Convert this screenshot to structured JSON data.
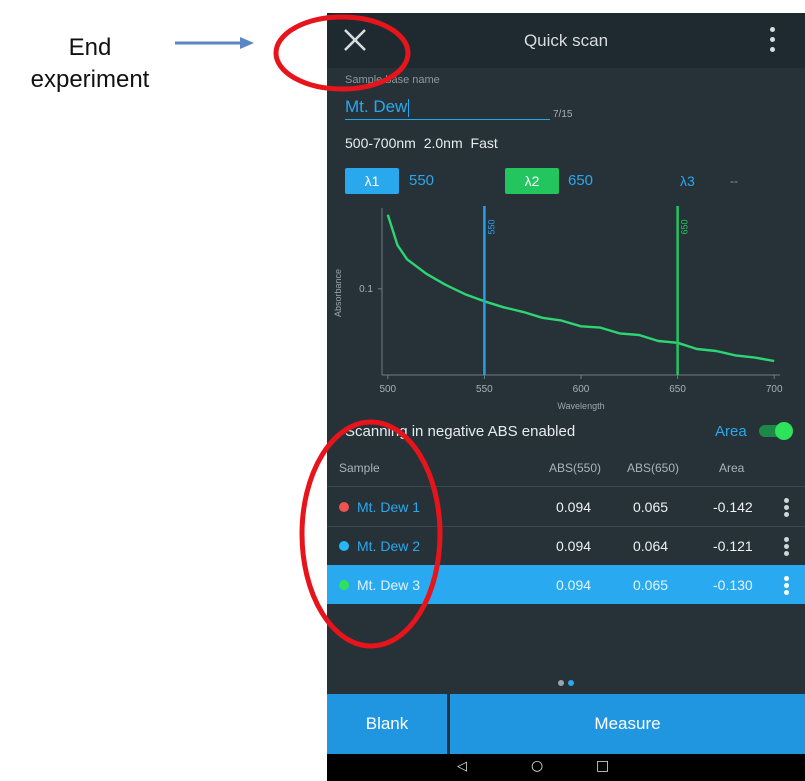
{
  "annotation": {
    "line1": "End",
    "line2": "experiment"
  },
  "header": {
    "title": "Quick scan"
  },
  "sample": {
    "label": "Sample base name",
    "value": "Mt. Dew",
    "counter": "7/15"
  },
  "params": {
    "range": "500-700nm",
    "resolution": "2.0nm",
    "speed": "Fast"
  },
  "lambdas": [
    {
      "label": "λ1",
      "value": "550",
      "color": "#2aa8ee"
    },
    {
      "label": "λ2",
      "value": "650",
      "color": "#22c55e"
    },
    {
      "label": "λ3",
      "value": "--",
      "color": "#2aa8ee"
    }
  ],
  "chart_data": {
    "type": "line",
    "xlabel": "Wavelength",
    "ylabel": "Absorbance",
    "x_ticks": [
      "500",
      "550",
      "600",
      "650",
      "700"
    ],
    "y_ticks": [
      "0.1"
    ],
    "xlim": [
      497,
      703
    ],
    "log_y": true,
    "ylim": [
      0.055,
      0.18
    ],
    "markers": [
      {
        "label": "550",
        "x": 550,
        "color": "#2a9fe8"
      },
      {
        "label": "650",
        "x": 650,
        "color": "#22c55e"
      }
    ],
    "series": [
      {
        "color": "#2ed573",
        "x": [
          500,
          505,
          510,
          520,
          530,
          540,
          550,
          560,
          570,
          580,
          590,
          600,
          610,
          620,
          630,
          640,
          650,
          660,
          670,
          680,
          690,
          700
        ],
        "y": [
          0.175,
          0.139,
          0.125,
          0.112,
          0.103,
          0.096,
          0.091,
          0.087,
          0.084,
          0.081,
          0.078,
          0.076,
          0.074,
          0.072,
          0.07,
          0.068,
          0.066,
          0.064,
          0.062,
          0.061,
          0.059,
          0.058
        ]
      }
    ]
  },
  "options": {
    "negative_abs": "Scanning in negative ABS enabled",
    "area_label": "Area",
    "area_enabled": true
  },
  "table": {
    "headers": [
      "Sample",
      "ABS(550)",
      "ABS(650)",
      "Area"
    ],
    "rows": [
      {
        "name": "Mt. Dew 1",
        "color": "#ef5350",
        "abs550": "0.094",
        "abs650": "0.065",
        "area": "-0.142",
        "selected": false
      },
      {
        "name": "Mt. Dew 2",
        "color": "#29b6f6",
        "abs550": "0.094",
        "abs650": "0.064",
        "area": "-0.121",
        "selected": false
      },
      {
        "name": "Mt. Dew 3",
        "color": "#2ee25c",
        "abs550": "0.094",
        "abs650": "0.065",
        "area": "-0.130",
        "selected": true
      }
    ]
  },
  "buttons": {
    "blank": "Blank",
    "measure": "Measure"
  },
  "nav": {
    "back": "◁",
    "home": "○",
    "recents": "□"
  },
  "colors": {
    "accent": "#2196e0",
    "highlight": "#29aaf0",
    "annotation": "#e8141c",
    "arrow": "#5b86c4"
  }
}
